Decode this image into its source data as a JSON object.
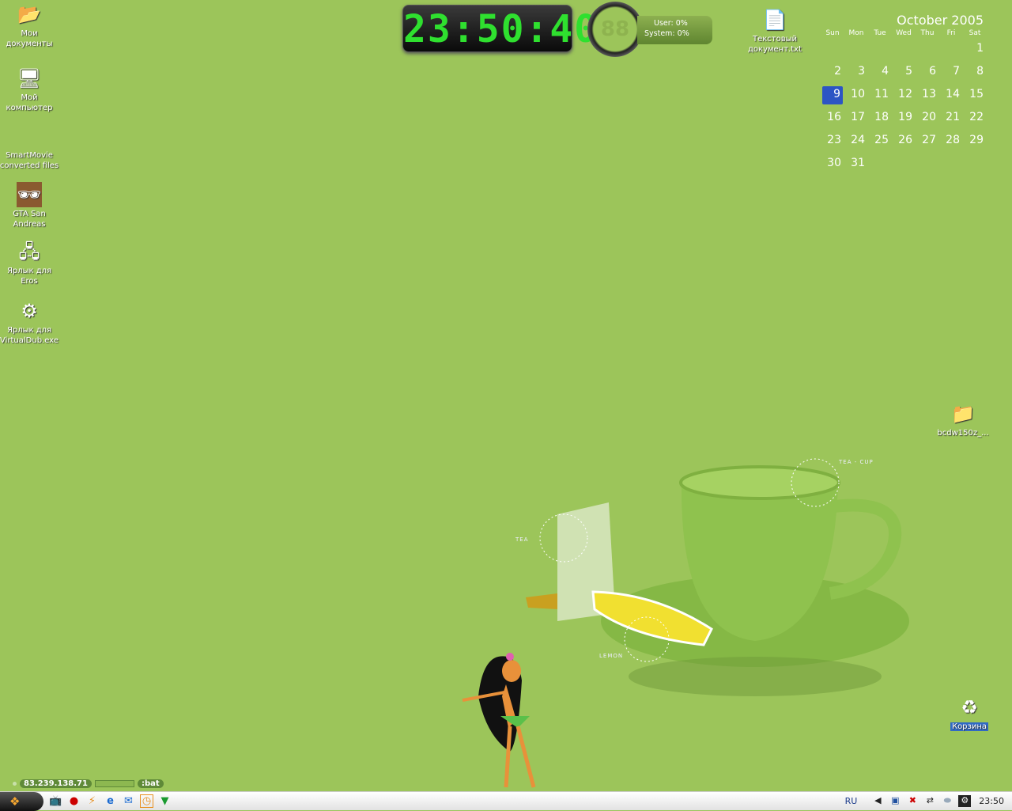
{
  "desktop_icons": [
    {
      "label": "Мои документы",
      "icon": "folder-documents-icon"
    },
    {
      "label": "Мой компьютер",
      "icon": "computer-icon"
    },
    {
      "label": "SmartMovie converted files",
      "icon": "folder-icon"
    },
    {
      "label": "GTA San Andreas",
      "icon": "game-shortcut-icon"
    },
    {
      "label": "Ярлык для Eros",
      "icon": "network-shortcut-icon"
    },
    {
      "label": "Ярлык для VirtualDub.exe",
      "icon": "app-shortcut-icon"
    },
    {
      "label": "Текстовый документ.txt",
      "icon": "text-file-icon"
    },
    {
      "label": "bcdw150z_...",
      "icon": "folder-icon"
    },
    {
      "label": "Корзина",
      "icon": "recycle-bin-icon"
    }
  ],
  "clock_widget": {
    "time": "23:50:40"
  },
  "cpu_widget": {
    "value": "88",
    "user": "User: 0%",
    "system": "System: 0%"
  },
  "calendar": {
    "title": "October 2005",
    "weekdays": [
      "Sun",
      "Mon",
      "Tue",
      "Wed",
      "Thu",
      "Fri",
      "Sat"
    ],
    "first_weekday": 6,
    "days": 31,
    "selected": 9
  },
  "wallpaper_labels": {
    "cup": "TEA - CUP",
    "tea": "TEA",
    "lemon": "LEMON"
  },
  "net_widget": {
    "ip": "83.239.138.71",
    "battery": ":bat"
  },
  "taskbar": {
    "quick_launch": [
      "tv-icon",
      "media-player-icon",
      "winamp-icon",
      "internet-explorer-icon",
      "outlook-icon",
      "clock-icon",
      "download-arrow-icon"
    ],
    "lang": "RU",
    "time": "23:50"
  },
  "colors": {
    "desktop": "#9cc55a",
    "clock_digits": "#2fe02f",
    "calendar_selected": "#2c55c4"
  }
}
